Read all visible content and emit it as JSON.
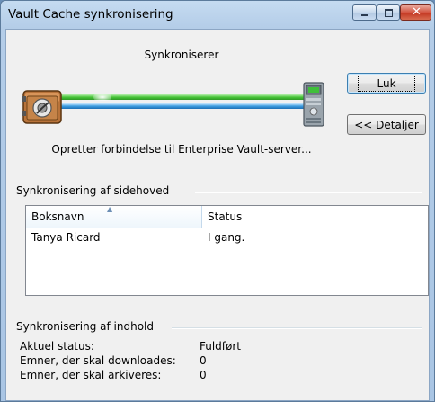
{
  "window": {
    "title": "Vault Cache synkronisering"
  },
  "progress": {
    "heading": "Synkroniserer",
    "status_text": "Opretter forbindelse til Enterprise Vault-server..."
  },
  "buttons": {
    "close_label": "Luk",
    "details_label": "<< Detaljer"
  },
  "header_sync": {
    "section_label": "Synkronisering af sidehoved",
    "columns": [
      "Boksnavn",
      "Status"
    ],
    "rows": [
      {
        "name": "Tanya Ricard",
        "status": "I gang."
      }
    ]
  },
  "content_sync": {
    "section_label": "Synkronisering af indhold",
    "items": [
      {
        "label": "Aktuel status:",
        "value": "Fuldført"
      },
      {
        "label": "Emner, der skal downloades:",
        "value": "0"
      },
      {
        "label": "Emner, der skal arkiveres:",
        "value": "0"
      }
    ]
  },
  "icons": {
    "vault": "vault-safe-icon",
    "server": "server-icon"
  },
  "colors": {
    "pipe_green": "#49c63a",
    "pipe_blue": "#3d9de0",
    "titlebar": "#b4cde8"
  }
}
